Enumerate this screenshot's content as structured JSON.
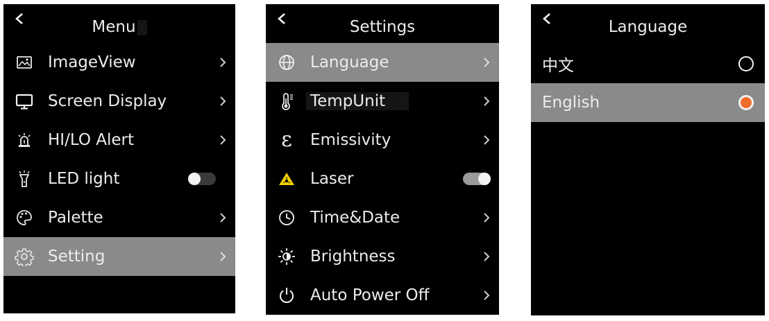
{
  "menu_screen": {
    "title": "Menu",
    "items": [
      {
        "label": "ImageView",
        "icon": "image-icon"
      },
      {
        "label": "Screen Display",
        "icon": "monitor-icon"
      },
      {
        "label": "HI/LO Alert",
        "icon": "alarm-light-icon"
      },
      {
        "label": "LED light",
        "icon": "flashlight-icon",
        "toggle": "off"
      },
      {
        "label": "Palette",
        "icon": "palette-icon"
      },
      {
        "label": "Setting",
        "icon": "gear-icon",
        "selected": true
      }
    ]
  },
  "settings_screen": {
    "title": "Settings",
    "items": [
      {
        "label": "Language",
        "icon": "globe-icon",
        "selected": true
      },
      {
        "label": "TempUnit",
        "icon": "thermometer-icon"
      },
      {
        "label": "Emissivity",
        "icon": "epsilon-icon",
        "glyph": "ε"
      },
      {
        "label": "Laser",
        "icon": "laser-warning-icon",
        "toggle": "on"
      },
      {
        "label": "Time&Date",
        "icon": "clock-icon"
      },
      {
        "label": "Brightness",
        "icon": "brightness-icon"
      },
      {
        "label": "Auto Power Off",
        "icon": "power-icon"
      }
    ]
  },
  "language_screen": {
    "title": "Language",
    "options": [
      {
        "label": "中文",
        "checked": false
      },
      {
        "label": "English",
        "checked": true
      }
    ]
  },
  "colors": {
    "background": "#000000",
    "selected_row": "#8a8a8a",
    "text": "#ececec",
    "radio_accent": "#f26c2a",
    "laser_yellow": "#f0d000"
  }
}
